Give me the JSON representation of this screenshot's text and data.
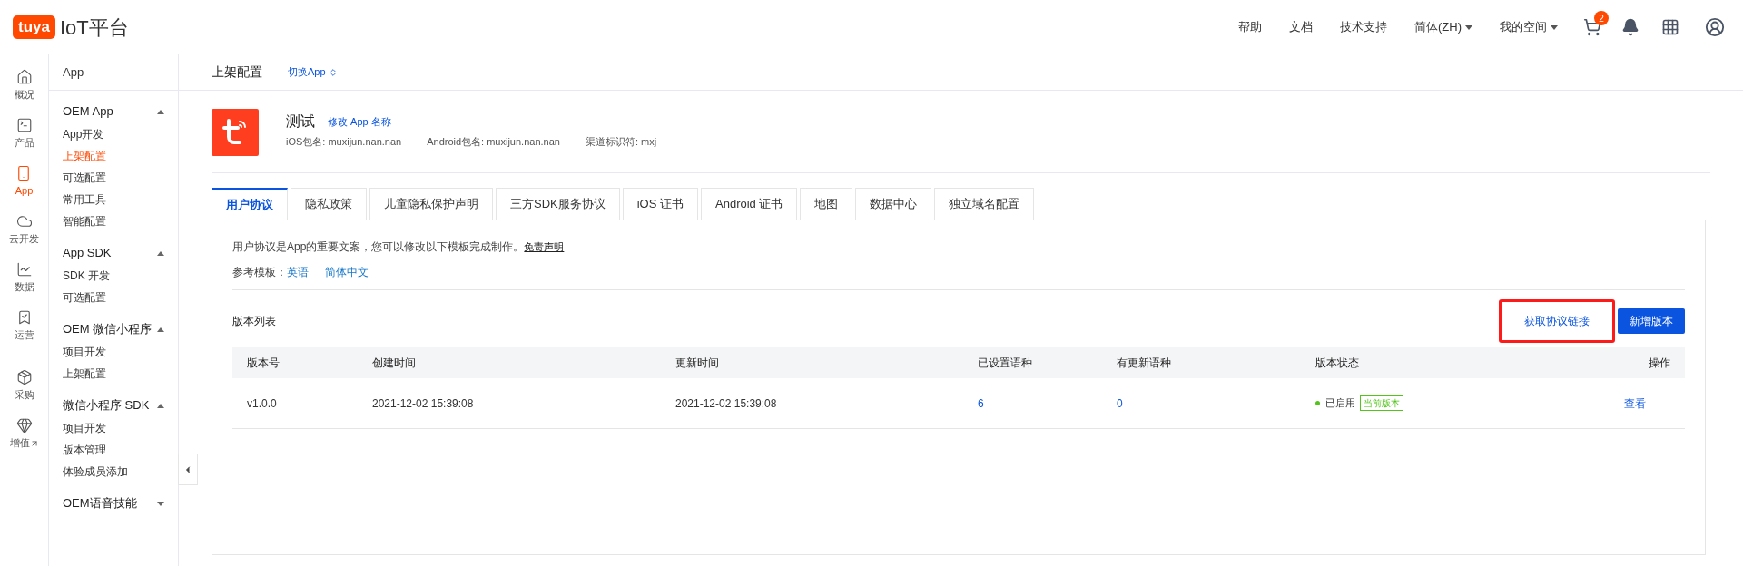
{
  "header": {
    "logo": "tuya",
    "title": "IoT平台",
    "links": [
      {
        "label": "帮助",
        "dropdown": false
      },
      {
        "label": "文档",
        "dropdown": false
      },
      {
        "label": "技术支持",
        "dropdown": false
      },
      {
        "label": "简体(ZH)",
        "dropdown": true
      },
      {
        "label": "我的空间",
        "dropdown": true
      }
    ],
    "cart_badge": "2"
  },
  "icon_rail": {
    "main": [
      {
        "kind": "home",
        "label": "概况",
        "selected": false,
        "external": false
      },
      {
        "kind": "terminal",
        "label": "产品",
        "selected": false,
        "external": false
      },
      {
        "kind": "phone",
        "label": "App",
        "selected": true,
        "external": false
      },
      {
        "kind": "cloud",
        "label": "云开发",
        "selected": false,
        "external": false
      },
      {
        "kind": "chart",
        "label": "数据",
        "selected": false,
        "external": false
      },
      {
        "kind": "bookmark",
        "label": "运营",
        "selected": false,
        "external": false
      }
    ],
    "secondary": [
      {
        "kind": "box",
        "label": "采购",
        "selected": false,
        "external": false
      },
      {
        "kind": "diamond",
        "label": "增值",
        "selected": false,
        "external": true
      }
    ]
  },
  "sidebar": {
    "title": "App",
    "groups": [
      {
        "label": "OEM App",
        "expanded": true,
        "items": [
          {
            "label": "App开发",
            "selected": false
          },
          {
            "label": "上架配置",
            "selected": true
          },
          {
            "label": "可选配置",
            "selected": false
          },
          {
            "label": "常用工具",
            "selected": false
          },
          {
            "label": "智能配置",
            "selected": false
          }
        ]
      },
      {
        "label": "App SDK",
        "expanded": true,
        "items": [
          {
            "label": "SDK 开发",
            "selected": false
          },
          {
            "label": "可选配置",
            "selected": false
          }
        ]
      },
      {
        "label": "OEM 微信小程序",
        "expanded": true,
        "items": [
          {
            "label": "项目开发",
            "selected": false
          },
          {
            "label": "上架配置",
            "selected": false
          }
        ]
      },
      {
        "label": "微信小程序 SDK",
        "expanded": true,
        "items": [
          {
            "label": "项目开发",
            "selected": false
          },
          {
            "label": "版本管理",
            "selected": false
          },
          {
            "label": "体验成员添加",
            "selected": false
          }
        ]
      },
      {
        "label": "OEM语音技能",
        "expanded": false
      }
    ]
  },
  "page": {
    "title": "上架配置",
    "switch_link": "切换App"
  },
  "app": {
    "name": "测试",
    "rename_link": "修改 App 名称",
    "meta": [
      "iOS包名: muxijun.nan.nan",
      "Android包名: muxijun.nan.nan",
      "渠道标识符: mxj"
    ]
  },
  "tabs": [
    {
      "label": "用户协议",
      "selected": true
    },
    {
      "label": "隐私政策",
      "selected": false
    },
    {
      "label": "儿童隐私保护声明",
      "selected": false
    },
    {
      "label": "三方SDK服务协议",
      "selected": false
    },
    {
      "label": "iOS 证书",
      "selected": false
    },
    {
      "label": "Android 证书",
      "selected": false
    },
    {
      "label": "地图",
      "selected": false
    },
    {
      "label": "数据中心",
      "selected": false
    },
    {
      "label": "独立域名配置",
      "selected": false
    }
  ],
  "intro": {
    "text": "用户协议是App的重要文案，您可以修改以下模板完成制作。",
    "disclaimer_link": "免责声明"
  },
  "templates": {
    "label": "参考模板：",
    "links": [
      "英语",
      "简体中文"
    ]
  },
  "version_list": {
    "title": "版本列表",
    "get_link_button": {
      "label": "获取协议链接",
      "highlighted": true
    },
    "new_button": "新增版本"
  },
  "table": {
    "columns": [
      "版本号",
      "创建时间",
      "更新时间",
      "已设置语种",
      "有更新语种",
      "版本状态",
      "操作"
    ],
    "rows": [
      {
        "version": "v1.0.0",
        "created": "2021-12-02 15:39:08",
        "updated": "2021-12-02 15:39:08",
        "languages_set": "6",
        "languages_updated": "0",
        "status": "已启用",
        "color": "#52c41a",
        "tag": "当前版本",
        "action": "查看"
      }
    ]
  }
}
